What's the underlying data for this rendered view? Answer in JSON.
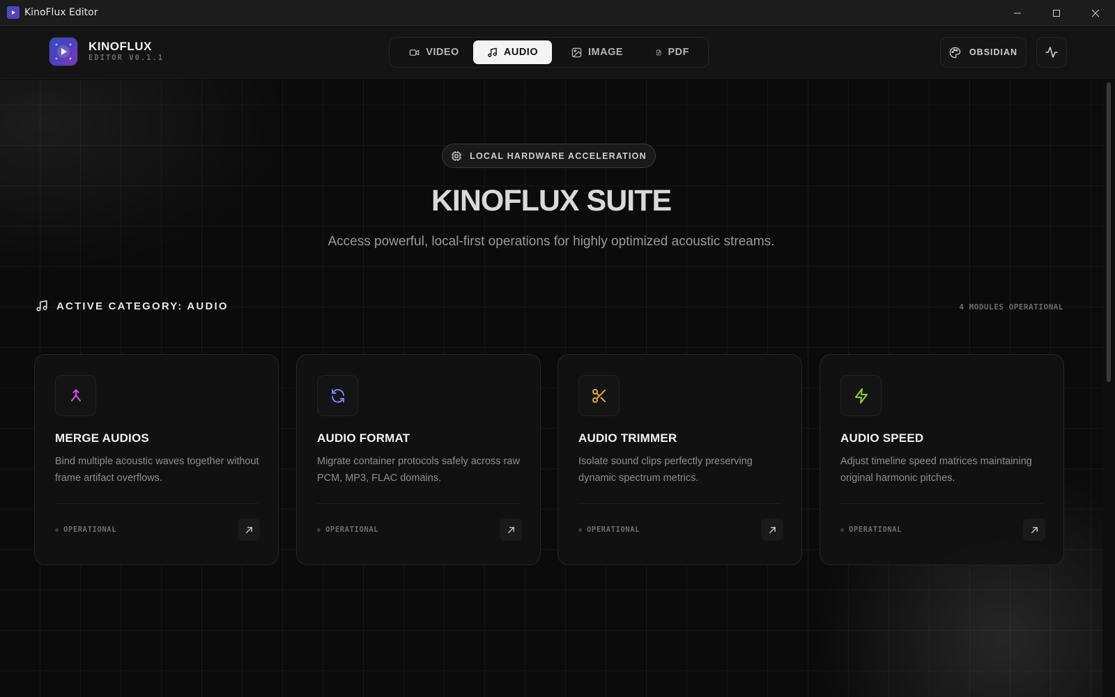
{
  "window": {
    "title": "KinoFlux Editor",
    "icon": "app-logo-icon",
    "controls": [
      "minimize-icon",
      "maximize-icon",
      "close-icon"
    ]
  },
  "header": {
    "brand_name": "KINOFLUX",
    "brand_version": "EDITOR V0.1.1",
    "tabs": [
      {
        "label": "VIDEO",
        "icon": "video-icon",
        "active": false
      },
      {
        "label": "AUDIO",
        "icon": "music-note-icon",
        "active": true
      },
      {
        "label": "IMAGE",
        "icon": "image-icon",
        "active": false
      },
      {
        "label": "PDF",
        "icon": "file-text-icon",
        "active": false
      }
    ],
    "theme_label": "OBSIDIAN",
    "theme_icon": "palette-icon",
    "activity_icon": "activity-icon"
  },
  "hero": {
    "badge": "LOCAL HARDWARE ACCELERATION",
    "badge_icon": "cpu-icon",
    "title": "KINOFLUX SUITE",
    "subtitle": "Access powerful, local-first operations for highly optimized acoustic streams."
  },
  "category": {
    "label": "ACTIVE CATEGORY: AUDIO",
    "icon": "music-note-icon",
    "count": "4 MODULES OPERATIONAL"
  },
  "cards": [
    {
      "title": "MERGE AUDIOS",
      "desc": "Bind multiple acoustic waves together without frame artifact overflows.",
      "status": "OPERATIONAL",
      "icon": "merge-icon",
      "accent": "#d552e8"
    },
    {
      "title": "AUDIO FORMAT",
      "desc": "Migrate container protocols safely across raw PCM, MP3, FLAC domains.",
      "status": "OPERATIONAL",
      "icon": "refresh-icon",
      "accent": "#7b7ef0"
    },
    {
      "title": "AUDIO TRIMMER",
      "desc": "Isolate sound clips perfectly preserving dynamic spectrum metrics.",
      "status": "OPERATIONAL",
      "icon": "scissors-icon",
      "accent": "#e8a92a"
    },
    {
      "title": "AUDIO SPEED",
      "desc": "Adjust timeline speed matrices maintaining original harmonic pitches.",
      "status": "OPERATIONAL",
      "icon": "zap-icon",
      "accent": "#8ad12f"
    }
  ]
}
